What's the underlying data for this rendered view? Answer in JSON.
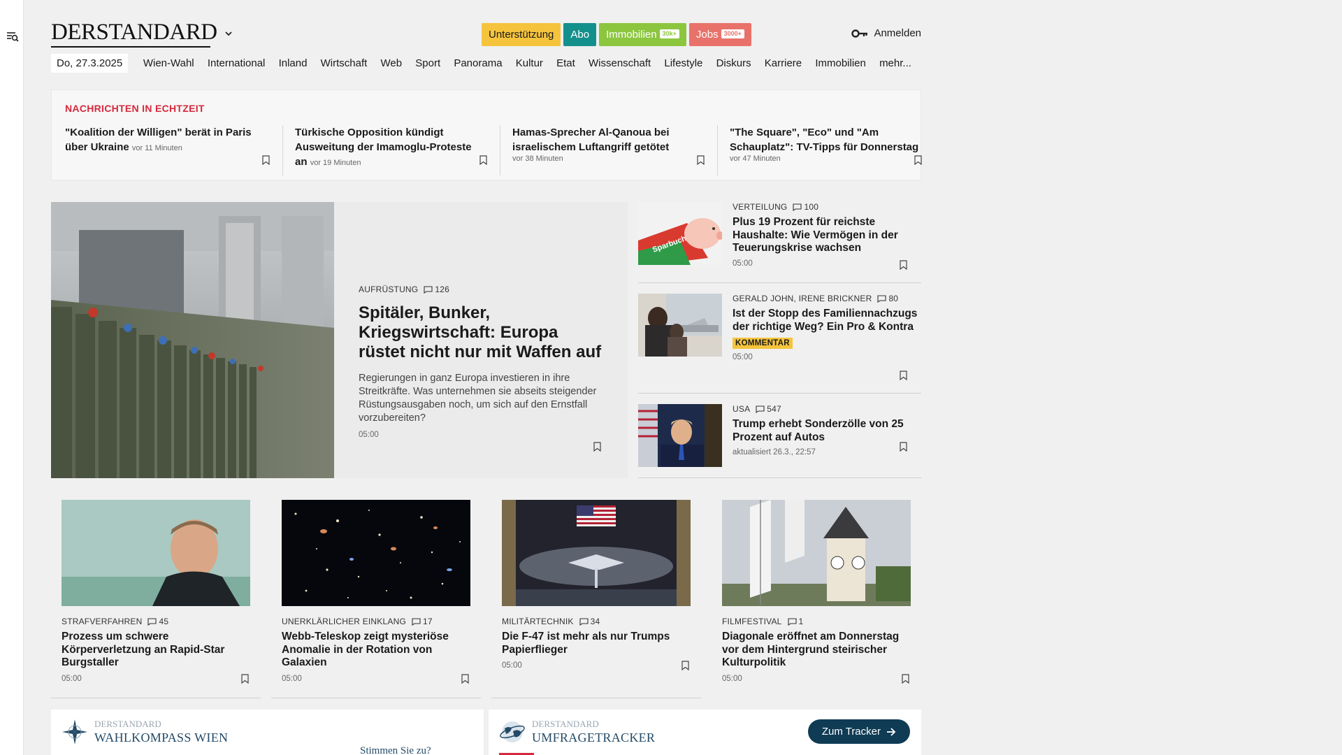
{
  "brand": {
    "logo": "DERSTANDARD"
  },
  "header": {
    "pills": [
      {
        "label": "Unterstützung",
        "tag": ""
      },
      {
        "label": "Abo",
        "tag": ""
      },
      {
        "label": "Immobilien",
        "tag": "30k+"
      },
      {
        "label": "Jobs",
        "tag": "3000+"
      }
    ],
    "login": "Anmelden"
  },
  "nav": {
    "date": "Do, 27.3.2025",
    "items": [
      "Wien-Wahl",
      "International",
      "Inland",
      "Wirtschaft",
      "Web",
      "Sport",
      "Panorama",
      "Kultur",
      "Etat",
      "Wissenschaft",
      "Lifestyle",
      "Diskurs",
      "Karriere",
      "Immobilien",
      "mehr..."
    ]
  },
  "live": {
    "heading": "NACHRICHTEN IN ECHTZEIT",
    "items": [
      {
        "title": "\"Koalition der Willigen\" berät in Paris über Ukraine",
        "time": "vor 11 Minuten"
      },
      {
        "title": "Türkische Opposition kündigt Ausweitung der Imamoglu-Proteste an",
        "time": "vor 19 Minuten"
      },
      {
        "title": "Hamas-Sprecher Al-Qanoua bei israelischem Luftangriff getötet",
        "time": "vor 38 Minuten"
      },
      {
        "title": "\"The Square\", \"Eco\" und \"Am Schauplatz\": TV-Tipps für Donnerstag",
        "time": "vor 47 Minuten"
      }
    ]
  },
  "lead": {
    "kicker": "AUFRÜSTUNG",
    "comments": "126",
    "title": "Spitäler, Bunker, Kriegswirtschaft: Europa rüstet nicht nur mit Waffen auf",
    "teaser": "Regierungen in ganz Europa investieren in ihre Streitkräfte. Was unternehmen sie abseits steigender Rüstungsausgaben noch, um sich auf den Ernstfall vorzubereiten?",
    "time": "05:00"
  },
  "side": [
    {
      "kicker": "VERTEILUNG",
      "comments": "100",
      "title": "Plus 19 Prozent für reichste Haushalte: Wie Vermögen in der Teuerungskrise wachsen",
      "badge": "",
      "time": "05:00",
      "image_text": "Sparbuch"
    },
    {
      "kicker": "GERALD JOHN, IRENE BRICKNER",
      "comments": "80",
      "title": "Ist der Stopp des Familiennachzugs der richtige Weg? Ein Pro & Kontra",
      "badge": "KOMMENTAR",
      "time": "05:00"
    },
    {
      "kicker": "USA",
      "comments": "547",
      "title": "Trump erhebt Sonderzölle von 25 Prozent auf Autos",
      "badge": "",
      "time": "aktualisiert 26.3., 22:57"
    }
  ],
  "cards": [
    {
      "kicker": "STRAFVERFAHREN",
      "comments": "45",
      "title": "Prozess um schwere Körperverletzung an Rapid-Star Burgstaller",
      "time": "05:00"
    },
    {
      "kicker": "UNERKLÄRLICHER EINKLANG",
      "comments": "17",
      "title": "Webb-Teleskop zeigt mysteriöse Anomalie in der Rotation von Galaxien",
      "time": "05:00"
    },
    {
      "kicker": "MILITÄRTECHNIK",
      "comments": "34",
      "title": "Die F-47 ist mehr als nur Trumps Papierflieger",
      "time": "05:00"
    },
    {
      "kicker": "FILMFESTIVAL",
      "comments": "1",
      "title": "Diagonale eröffnet am Donnerstag vor dem Hintergrund steirischer Kulturpolitik",
      "time": "05:00"
    }
  ],
  "promos": {
    "wahl": {
      "brand": "DERSTANDARD",
      "name": "WAHLKOMPASS WIEN",
      "question": "Stimmen Sie zu?"
    },
    "umfrage": {
      "brand": "DERSTANDARD",
      "name": "UMFRAGETRACKER",
      "button": "Zum Tracker"
    }
  },
  "colors": {
    "live_heading": "#d6283c",
    "support": "#f5c43c",
    "abo": "#14908c",
    "immobilien": "#8cc63f",
    "jobs": "#e8726a",
    "tracker_button": "#0f3b55"
  }
}
